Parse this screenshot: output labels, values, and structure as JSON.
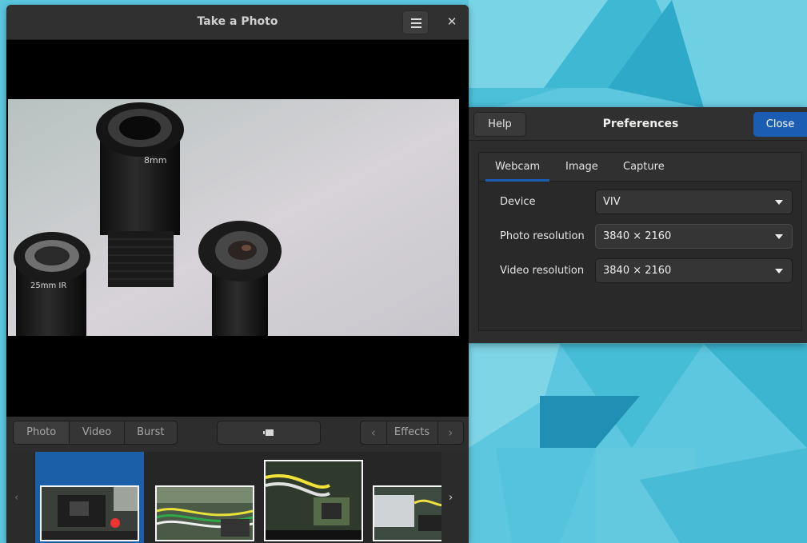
{
  "cheese": {
    "title": "Take a Photo",
    "modes": [
      "Photo",
      "Video",
      "Burst"
    ],
    "take_button_icon": "camera-shutter-icon",
    "effects_label": "Effects",
    "thumbnails_count": 4
  },
  "preferences": {
    "help_label": "Help",
    "title": "Preferences",
    "close_label": "Close",
    "tabs": [
      "Webcam",
      "Image",
      "Capture"
    ],
    "active_tab": "Webcam",
    "rows": [
      {
        "label": "Device",
        "value": "VIV"
      },
      {
        "label": "Photo resolution",
        "value": "3840 × 2160"
      },
      {
        "label": "Video resolution",
        "value": "3840 × 2160"
      }
    ]
  },
  "colors": {
    "accent": "#1b5db3",
    "wallpaper": "#5cc6de"
  }
}
